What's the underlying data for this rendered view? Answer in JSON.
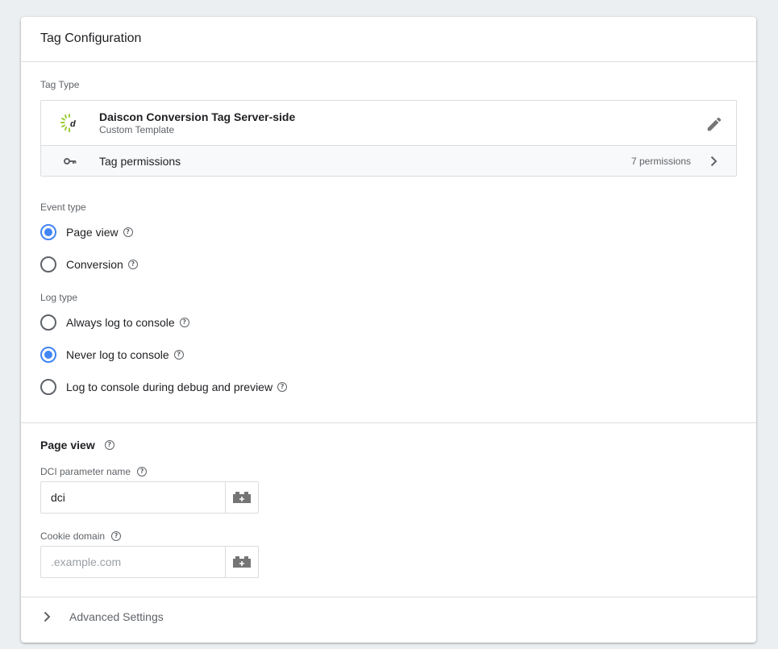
{
  "card": {
    "title": "Tag Configuration"
  },
  "tag_type": {
    "section_label": "Tag Type",
    "name": "Daiscon Conversion Tag Server-side",
    "subtitle": "Custom Template",
    "logo_icon": "daiscon-logo-icon",
    "edit_icon": "pencil-icon",
    "permissions": {
      "label": "Tag permissions",
      "count": "7 permissions",
      "icon": "key-icon"
    }
  },
  "event_type": {
    "label": "Event type",
    "options": [
      {
        "label": "Page view",
        "checked": true
      },
      {
        "label": "Conversion",
        "checked": false
      }
    ]
  },
  "log_type": {
    "label": "Log type",
    "options": [
      {
        "label": "Always log to console",
        "checked": false
      },
      {
        "label": "Never log to console",
        "checked": true
      },
      {
        "label": "Log to console during debug and preview",
        "checked": false
      }
    ]
  },
  "page_view": {
    "title": "Page view",
    "fields": [
      {
        "label": "DCI parameter name",
        "value": "dci",
        "placeholder": ""
      },
      {
        "label": "Cookie domain",
        "value": "",
        "placeholder": ".example.com"
      }
    ]
  },
  "advanced": {
    "label": "Advanced Settings"
  },
  "colors": {
    "accent": "#4285f4",
    "logo_green": "#9acd32",
    "text": "#202124",
    "muted": "#5f6368",
    "border": "#dadce0"
  }
}
